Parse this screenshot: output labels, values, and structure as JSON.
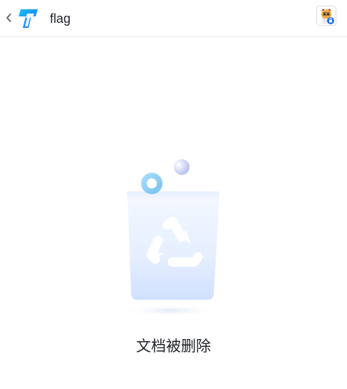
{
  "header": {
    "title": "flag",
    "back_icon": "chevron-left-icon",
    "logo_icon": "app-logo-icon",
    "avatar_icon": "user-avatar-icon"
  },
  "main": {
    "empty_state_text": "文档被删除",
    "illustration_icon": "recycle-bin-icon"
  },
  "colors": {
    "logo_blue": "#1e6bff",
    "logo_cyan": "#17c2f2",
    "bin_light": "#eef4ff",
    "bin_blue": "#cfe0ff",
    "ring_blue": "#8fd0f5",
    "ball_lavender": "#c9cdf7",
    "text": "#1f2329"
  }
}
